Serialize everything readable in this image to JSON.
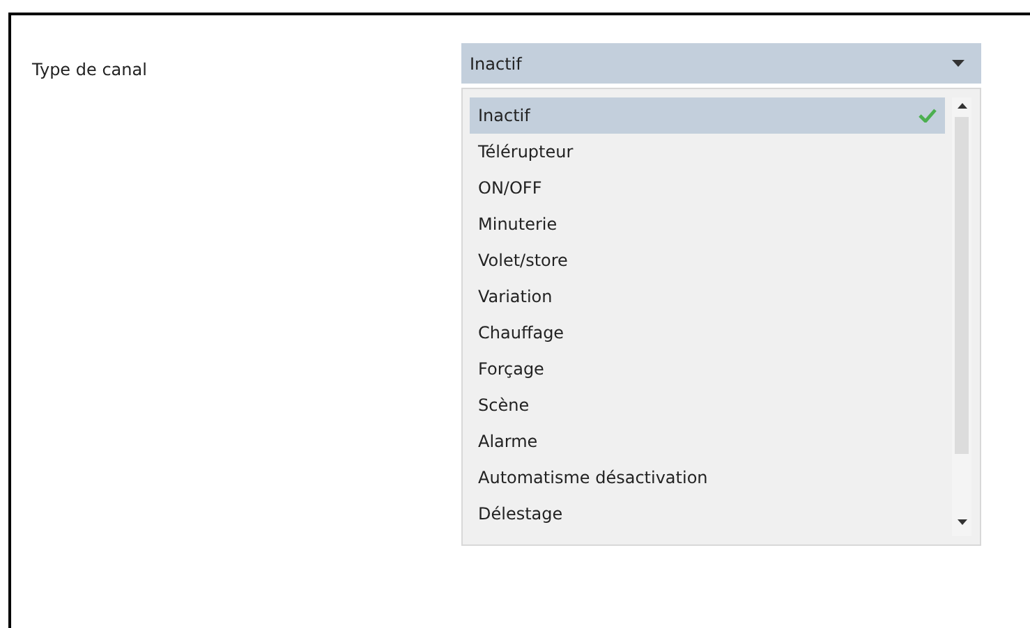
{
  "label": "Type de canal",
  "combo": {
    "value": "Inactif"
  },
  "options": [
    {
      "label": "Inactif",
      "selected": true
    },
    {
      "label": "Télérupteur",
      "selected": false
    },
    {
      "label": "ON/OFF",
      "selected": false
    },
    {
      "label": "Minuterie",
      "selected": false
    },
    {
      "label": "Volet/store",
      "selected": false
    },
    {
      "label": "Variation",
      "selected": false
    },
    {
      "label": "Chauffage",
      "selected": false
    },
    {
      "label": "Forçage",
      "selected": false
    },
    {
      "label": "Scène",
      "selected": false
    },
    {
      "label": "Alarme",
      "selected": false
    },
    {
      "label": "Automatisme désactivation",
      "selected": false
    },
    {
      "label": "Délestage",
      "selected": false
    }
  ]
}
